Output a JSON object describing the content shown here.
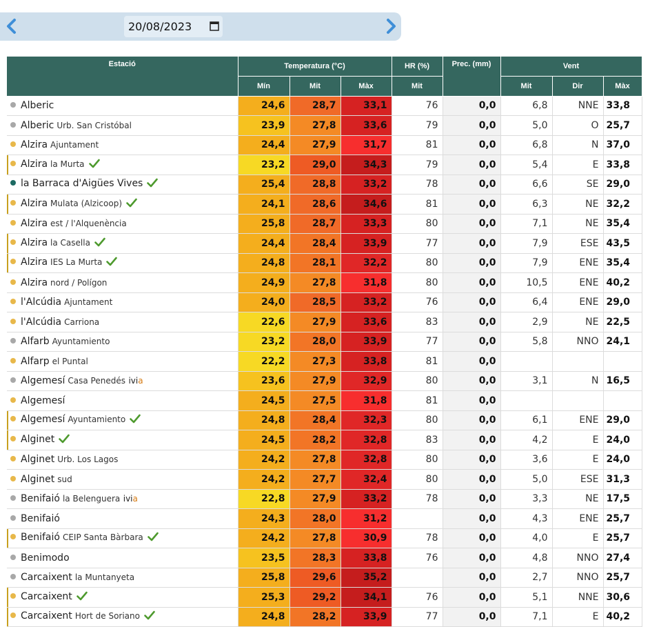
{
  "date": "20/08/2023",
  "icons": {
    "prev": "chevron-left-icon",
    "next": "chevron-right-icon",
    "calendar": "calendar-icon",
    "check": "check-icon"
  },
  "colors": {
    "header": "#35675f",
    "dot_yellow": "#e8b84a",
    "dot_gray": "#a8a8a8",
    "dot_teal": "#1c6a62",
    "check": "#4e9a2e"
  },
  "headers": {
    "station": "Estació",
    "temperature": "Temperatura (°C)",
    "hr": "HR (%)",
    "prec": "Prec. (mm)",
    "wind": "Vent",
    "t_min": "Mín",
    "t_mit": "Mit",
    "t_max": "Màx",
    "hr_mit": "Mit",
    "w_mit": "Mit",
    "w_dir": "Dir",
    "w_max": "Màx"
  },
  "rows": [
    {
      "name": "Alberic",
      "sub": "",
      "dot": "gray",
      "check": false,
      "ivi": false,
      "flag": false,
      "tmin": "24,6",
      "tmit": "28,7",
      "tmax": "33,1",
      "hr": "76",
      "prec": "0,0",
      "wmit": "6,8",
      "wdir": "NNE",
      "wmax": "33,8"
    },
    {
      "name": "Alberic",
      "sub": "Urb. San Cristóbal",
      "dot": "gray",
      "check": false,
      "ivi": false,
      "flag": false,
      "tmin": "23,9",
      "tmit": "27,8",
      "tmax": "33,6",
      "hr": "79",
      "prec": "0,0",
      "wmit": "5,0",
      "wdir": "O",
      "wmax": "25,7"
    },
    {
      "name": "Alzira",
      "sub": "Ajuntament",
      "dot": "yellow",
      "check": false,
      "ivi": false,
      "flag": false,
      "tmin": "24,4",
      "tmit": "27,9",
      "tmax": "31,7",
      "hr": "81",
      "prec": "0,0",
      "wmit": "6,8",
      "wdir": "N",
      "wmax": "37,0"
    },
    {
      "name": "Alzira",
      "sub": "la Murta",
      "dot": "yellow",
      "check": true,
      "ivi": false,
      "flag": true,
      "tmin": "23,2",
      "tmit": "29,0",
      "tmax": "34,3",
      "hr": "79",
      "prec": "0,0",
      "wmit": "5,4",
      "wdir": "E",
      "wmax": "33,8"
    },
    {
      "name": "la Barraca d'Aigües Vives",
      "sub": "",
      "dot": "teal",
      "check": true,
      "ivi": false,
      "flag": false,
      "tmin": "25,4",
      "tmit": "28,8",
      "tmax": "33,2",
      "hr": "78",
      "prec": "0,0",
      "wmit": "6,6",
      "wdir": "SE",
      "wmax": "29,0"
    },
    {
      "name": "Alzira",
      "sub": "Mulata (Alzicoop)",
      "dot": "yellow",
      "check": true,
      "ivi": false,
      "flag": true,
      "tmin": "24,1",
      "tmit": "28,6",
      "tmax": "34,6",
      "hr": "81",
      "prec": "0,0",
      "wmit": "6,3",
      "wdir": "NE",
      "wmax": "32,2"
    },
    {
      "name": "Alzira",
      "sub": "est / l'Alquenència",
      "dot": "yellow",
      "check": false,
      "ivi": false,
      "flag": false,
      "tmin": "25,8",
      "tmit": "28,7",
      "tmax": "33,3",
      "hr": "80",
      "prec": "0,0",
      "wmit": "7,1",
      "wdir": "NE",
      "wmax": "35,4"
    },
    {
      "name": "Alzira",
      "sub": "la Casella",
      "dot": "yellow",
      "check": true,
      "ivi": false,
      "flag": true,
      "tmin": "24,4",
      "tmit": "28,4",
      "tmax": "33,9",
      "hr": "77",
      "prec": "0,0",
      "wmit": "7,9",
      "wdir": "ESE",
      "wmax": "43,5"
    },
    {
      "name": "Alzira",
      "sub": "IES La Murta",
      "dot": "yellow",
      "check": true,
      "ivi": false,
      "flag": true,
      "tmin": "24,8",
      "tmit": "28,1",
      "tmax": "32,2",
      "hr": "80",
      "prec": "0,0",
      "wmit": "7,9",
      "wdir": "ENE",
      "wmax": "35,4"
    },
    {
      "name": "Alzira",
      "sub": "nord / Polígon",
      "dot": "yellow",
      "check": false,
      "ivi": false,
      "flag": false,
      "tmin": "24,9",
      "tmit": "27,8",
      "tmax": "31,8",
      "hr": "80",
      "prec": "0,0",
      "wmit": "10,5",
      "wdir": "ENE",
      "wmax": "40,2"
    },
    {
      "name": "l'Alcúdia",
      "sub": "Ajuntament",
      "dot": "yellow",
      "check": false,
      "ivi": false,
      "flag": false,
      "tmin": "24,0",
      "tmit": "28,5",
      "tmax": "33,2",
      "hr": "76",
      "prec": "0,0",
      "wmit": "6,4",
      "wdir": "ENE",
      "wmax": "29,0"
    },
    {
      "name": "l'Alcúdia",
      "sub": "Carriona",
      "dot": "yellow",
      "check": false,
      "ivi": false,
      "flag": false,
      "tmin": "22,6",
      "tmit": "27,9",
      "tmax": "33,6",
      "hr": "83",
      "prec": "0,0",
      "wmit": "2,9",
      "wdir": "NE",
      "wmax": "22,5"
    },
    {
      "name": "Alfarb",
      "sub": "Ayuntamiento",
      "dot": "gray",
      "check": false,
      "ivi": false,
      "flag": false,
      "tmin": "23,2",
      "tmit": "28,0",
      "tmax": "33,9",
      "hr": "77",
      "prec": "0,0",
      "wmit": "5,8",
      "wdir": "NNO",
      "wmax": "24,1"
    },
    {
      "name": "Alfarp",
      "sub": "el Puntal",
      "dot": "yellow",
      "check": false,
      "ivi": false,
      "flag": false,
      "tmin": "22,2",
      "tmit": "27,3",
      "tmax": "33,8",
      "hr": "81",
      "prec": "0,0",
      "wmit": "",
      "wdir": "",
      "wmax": ""
    },
    {
      "name": "Algemesí",
      "sub": "Casa Penedés",
      "dot": "gray",
      "check": false,
      "ivi": true,
      "flag": false,
      "tmin": "23,6",
      "tmit": "27,9",
      "tmax": "32,9",
      "hr": "80",
      "prec": "0,0",
      "wmit": "3,1",
      "wdir": "N",
      "wmax": "16,5"
    },
    {
      "name": "Algemesí",
      "sub": "",
      "dot": "yellow",
      "check": false,
      "ivi": false,
      "flag": false,
      "tmin": "24,5",
      "tmit": "27,5",
      "tmax": "31,8",
      "hr": "81",
      "prec": "0,0",
      "wmit": "",
      "wdir": "",
      "wmax": ""
    },
    {
      "name": "Algemesí",
      "sub": "Ayuntamiento",
      "dot": "yellow",
      "check": true,
      "ivi": false,
      "flag": true,
      "tmin": "24,8",
      "tmit": "28,4",
      "tmax": "32,3",
      "hr": "80",
      "prec": "0,0",
      "wmit": "6,1",
      "wdir": "ENE",
      "wmax": "29,0"
    },
    {
      "name": "Alginet",
      "sub": "",
      "dot": "yellow",
      "check": true,
      "ivi": false,
      "flag": true,
      "tmin": "24,5",
      "tmit": "28,2",
      "tmax": "32,8",
      "hr": "83",
      "prec": "0,0",
      "wmit": "4,2",
      "wdir": "E",
      "wmax": "24,0"
    },
    {
      "name": "Alginet",
      "sub": "Urb. Los Lagos",
      "dot": "yellow",
      "check": false,
      "ivi": false,
      "flag": false,
      "tmin": "24,2",
      "tmit": "27,8",
      "tmax": "32,8",
      "hr": "80",
      "prec": "0,0",
      "wmit": "3,6",
      "wdir": "E",
      "wmax": "24,0"
    },
    {
      "name": "Alginet",
      "sub": "sud",
      "dot": "yellow",
      "check": false,
      "ivi": false,
      "flag": false,
      "tmin": "24,2",
      "tmit": "27,7",
      "tmax": "32,4",
      "hr": "80",
      "prec": "0,0",
      "wmit": "5,0",
      "wdir": "ESE",
      "wmax": "31,3"
    },
    {
      "name": "Benifaió",
      "sub": "la Belenguera",
      "dot": "gray",
      "check": false,
      "ivi": true,
      "flag": false,
      "tmin": "22,8",
      "tmit": "27,9",
      "tmax": "33,2",
      "hr": "78",
      "prec": "0,0",
      "wmit": "3,3",
      "wdir": "NE",
      "wmax": "17,5"
    },
    {
      "name": "Benifaió",
      "sub": "",
      "dot": "gray",
      "check": false,
      "ivi": false,
      "flag": false,
      "tmin": "24,3",
      "tmit": "28,0",
      "tmax": "31,2",
      "hr": "",
      "prec": "0,0",
      "wmit": "4,3",
      "wdir": "ENE",
      "wmax": "25,7"
    },
    {
      "name": "Benifaió",
      "sub": "CEIP Santa Bàrbara",
      "dot": "yellow",
      "check": true,
      "ivi": false,
      "flag": true,
      "tmin": "24,2",
      "tmit": "27,8",
      "tmax": "30,9",
      "hr": "78",
      "prec": "0,0",
      "wmit": "4,0",
      "wdir": "E",
      "wmax": "25,7"
    },
    {
      "name": "Benimodo",
      "sub": "",
      "dot": "gray",
      "check": false,
      "ivi": false,
      "flag": false,
      "tmin": "23,5",
      "tmit": "28,3",
      "tmax": "33,8",
      "hr": "76",
      "prec": "0,0",
      "wmit": "4,8",
      "wdir": "NNO",
      "wmax": "27,4"
    },
    {
      "name": "Carcaixent",
      "sub": "la Muntanyeta",
      "dot": "gray",
      "check": false,
      "ivi": false,
      "flag": false,
      "tmin": "25,8",
      "tmit": "29,6",
      "tmax": "35,2",
      "hr": "",
      "prec": "0,0",
      "wmit": "2,7",
      "wdir": "NNO",
      "wmax": "25,7"
    },
    {
      "name": "Carcaixent",
      "sub": "",
      "dot": "yellow",
      "check": true,
      "ivi": false,
      "flag": true,
      "tmin": "25,3",
      "tmit": "29,2",
      "tmax": "34,1",
      "hr": "76",
      "prec": "0,0",
      "wmit": "5,1",
      "wdir": "NNE",
      "wmax": "30,6"
    },
    {
      "name": "Carcaixent",
      "sub": "Hort de Soriano",
      "dot": "yellow",
      "check": true,
      "ivi": false,
      "flag": true,
      "tmin": "24,8",
      "tmit": "28,2",
      "tmax": "33,9",
      "hr": "77",
      "prec": "0,0",
      "wmit": "7,1",
      "wdir": "E",
      "wmax": "40,2"
    }
  ]
}
